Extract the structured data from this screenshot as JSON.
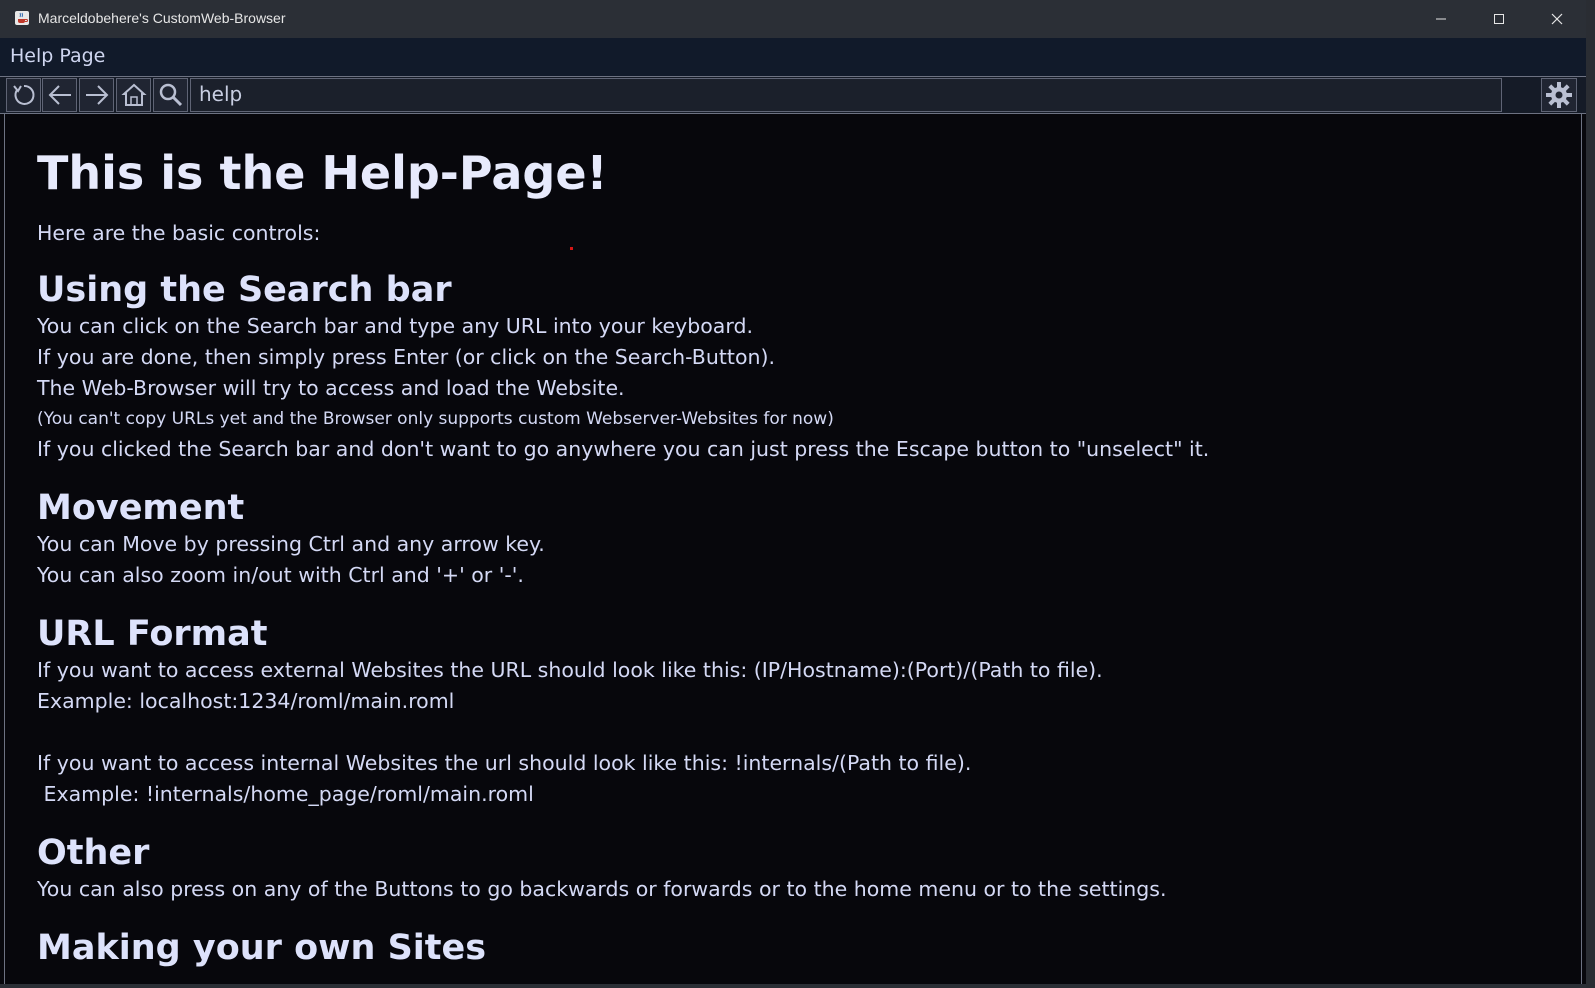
{
  "window": {
    "title": "Marceldobehere's CustomWeb-Browser",
    "app_icon": "java-cup-icon",
    "controls": [
      "minimize-icon",
      "maximize-icon",
      "close-icon"
    ]
  },
  "page_name": "Help Page",
  "toolbar": {
    "buttons": [
      "reload-icon",
      "back-arrow-icon",
      "forward-arrow-icon",
      "home-icon",
      "search-icon"
    ],
    "url_value": "help",
    "settings_icon": "gear-icon"
  },
  "content": {
    "title": "This is the Help-Page!",
    "intro": "Here are the basic controls:",
    "sections": {
      "search": {
        "heading": "Using the Search bar",
        "lines": [
          "You can click on the Search bar and type any URL into your keyboard.",
          "If you are done, then simply press Enter (or click on the Search-Button).",
          "The Web-Browser will try to access and load the Website."
        ],
        "note": "(You can't copy URLs yet and the Browser only supports custom Webserver-Websites for now)",
        "extra": "If you clicked the Search bar and don't want to go anywhere you can just press the Escape button to \"unselect\" it."
      },
      "movement": {
        "heading": "Movement",
        "lines": [
          "You can Move by pressing Ctrl and any arrow key.",
          "You can also zoom in/out with Ctrl and '+' or '-'."
        ]
      },
      "url_format": {
        "heading": "URL Format",
        "external": "If you want to access external Websites the URL should look like this: (IP/Hostname):(Port)/(Path to file).",
        "external_example": "Example: localhost:1234/roml/main.roml",
        "internal": "If you want to access internal Websites the url should look like this: !internals/(Path to file).",
        "internal_example": " Example: !internals/home_page/roml/main.roml"
      },
      "other": {
        "heading": "Other",
        "lines": [
          "You can also press on any of the Buttons to go backwards or forwards or to the home menu or to the settings."
        ]
      },
      "own_sites": {
        "heading": "Making your own Sites"
      }
    }
  },
  "colors": {
    "background": "#07070c",
    "text": "#d4d9f5",
    "titlebar": "#2b2f36",
    "toolbar": "#151b27"
  }
}
